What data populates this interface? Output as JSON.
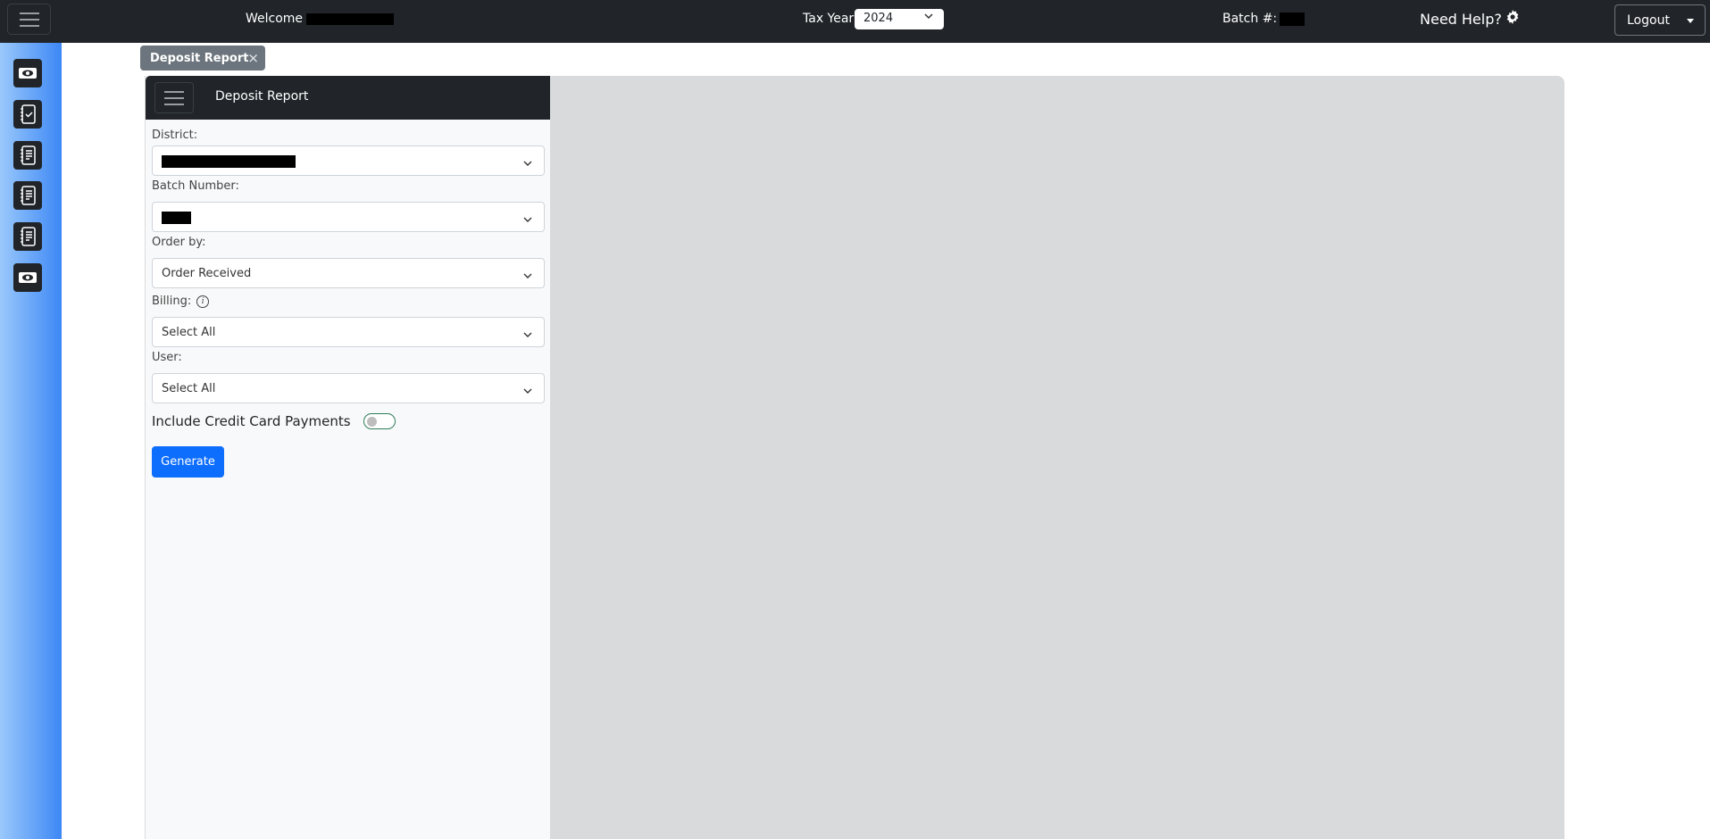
{
  "topbar": {
    "welcome_label": "Welcome",
    "welcome_name_redacted": true,
    "tax_year_label": "Tax Year",
    "tax_year_value": "2024",
    "batch_label": "Batch #:",
    "batch_value_redacted": true,
    "help_label": "Need Help?",
    "help_icon": "gear-icon",
    "logout_label": "Logout"
  },
  "sidebar": {
    "items": [
      {
        "icon": "money-icon"
      },
      {
        "icon": "checklist-icon"
      },
      {
        "icon": "notebook-icon"
      },
      {
        "icon": "notebook-icon"
      },
      {
        "icon": "notebook-icon"
      },
      {
        "icon": "money-icon"
      }
    ]
  },
  "tabs": [
    {
      "label": "Deposit Report",
      "close": "×",
      "active": true
    }
  ],
  "panel": {
    "title": "Deposit Report",
    "fields": {
      "district": {
        "label": "District:",
        "value_redacted": true
      },
      "batch_number": {
        "label": "Batch Number:",
        "value_redacted": true
      },
      "order_by": {
        "label": "Order by:",
        "value": "Order Received"
      },
      "billing": {
        "label": "Billing:",
        "value": "Select All",
        "info_icon": "i"
      },
      "user": {
        "label": "User:",
        "value": "Select All"
      }
    },
    "credit_card_toggle": {
      "label": "Include Credit Card Payments",
      "checked": false
    },
    "generate_label": "Generate"
  },
  "colors": {
    "topbar_bg": "#212529",
    "primary": "#0d6efd",
    "tab_bg": "#6c757d",
    "content_bg": "#d9dadc",
    "panel_bg": "#f8f9fa",
    "toggle_border": "#2e7d5b"
  }
}
